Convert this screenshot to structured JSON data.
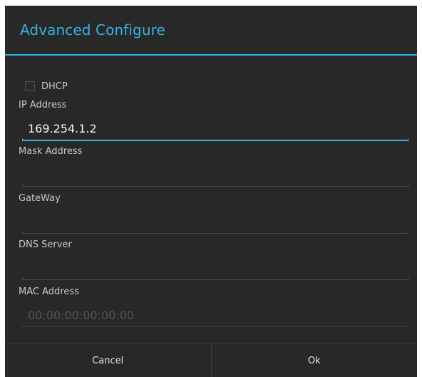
{
  "dialog": {
    "title": "Advanced Configure",
    "accent_color": "#33b5e5",
    "background_color": "#282828"
  },
  "dhcp": {
    "label": "DHCP",
    "checked": false
  },
  "fields": {
    "ip": {
      "label": "IP Address",
      "value": "169.254.1.2",
      "focused": true
    },
    "mask": {
      "label": "Mask Address",
      "value": ""
    },
    "gateway": {
      "label": "GateWay",
      "value": ""
    },
    "dns": {
      "label": "DNS Server",
      "value": ""
    },
    "mac": {
      "label": "MAC Address",
      "placeholder": "00:00:00:00:00:00",
      "disabled": true
    }
  },
  "buttons": {
    "cancel": "Cancel",
    "ok": "Ok"
  }
}
